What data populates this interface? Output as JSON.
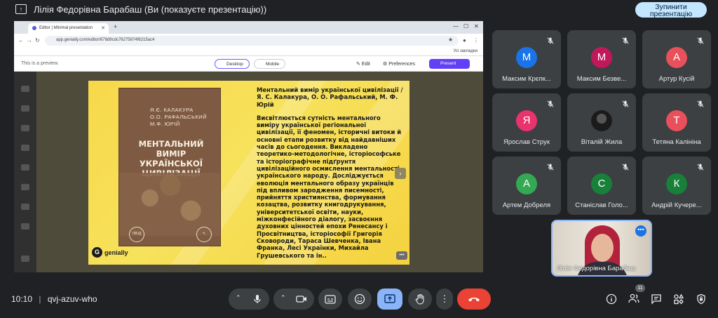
{
  "topbar": {
    "presenter_title": "Лілія Федорівна Барабаш (Ви (показуєте презентацію))",
    "stop_label_line1": "Зупинити",
    "stop_label_line2": "презентацію"
  },
  "browser": {
    "tab_title": "Editor | Minimal presentation",
    "url": "app.genially.com/editor/678d9cdc76275874f6215ac4",
    "bookmarks_label": "Усі закладки",
    "preview_note": "This is a preview.",
    "desktop_label": "Desktop",
    "mobile_label": "Mobile",
    "edit_label": "Edit",
    "preferences_label": "Preferences",
    "present_label": "Present"
  },
  "slide": {
    "book_authors": [
      "Я.Є. КАЛАКУРА",
      "О.О. РАФАЛЬСЬКИЙ",
      "М.Ф. ЮРІЙ"
    ],
    "book_title": "МЕНТАЛЬНИЙ ВИМІР УКРАЇНСЬКОЇ ЦИВІЛІЗАЦІЇ",
    "book_logo_left": "ЛІБІД",
    "citation": "Ментальний вимір української цивілізації / Я. С. Калакура, О. О. Рафальський, М. Ф. Юрій",
    "description": "Висвітлюється сутність ментального виміру української регіональної цивілізації, її феномен, історичні витоки й основні етапи розвитку від найдавніших часів до сьогодення. Викладено теоретико-методологічне, історіософське та історіографічне підґрунтя цивілізаційного осмислення ментальності українського народу. Досліджується еволюція ментального образу українців під впливом зародження писемності, прийняття християнства, формування козацтва, розвитку книгодрукування, університетської освіти, науки, міжконфесійного діалогу, засвоєння духовних цінностей епохи Ренесансу і Просвітництва, історіософії Григорія Сковороди, Тараса Шевченка, Івана Франка, Лесі Українки, Михайла Грушевського та ін..",
    "brand": "genially",
    "help_glyph": "?"
  },
  "participants": [
    {
      "initial": "М",
      "name": "Максим Крєпк...",
      "color": "#1a73e8"
    },
    {
      "initial": "М",
      "name": "Максим Безве...",
      "color": "#c2185b"
    },
    {
      "initial": "А",
      "name": "Артур Кусій",
      "color": "#e8505b"
    },
    {
      "initial": "Я",
      "name": "Ярослав Струк",
      "color": "#e8336d"
    },
    {
      "initial": "",
      "name": "Віталій Жила",
      "color": "#1b1b1b"
    },
    {
      "initial": "Т",
      "name": "Тетяна Калініна",
      "color": "#e8505b"
    },
    {
      "initial": "А",
      "name": "Артем Добреля",
      "color": "#34a853"
    },
    {
      "initial": "С",
      "name": "Станіслав Голо...",
      "color": "#188038"
    },
    {
      "initial": "К",
      "name": "Андрій Кучере...",
      "color": "#188038"
    }
  ],
  "self": {
    "name": "Лілія Федорівна Барабаш"
  },
  "bottombar": {
    "time": "10:10",
    "separator": "|",
    "meeting_code": "qvj-azuv-who",
    "participant_count": "11"
  }
}
